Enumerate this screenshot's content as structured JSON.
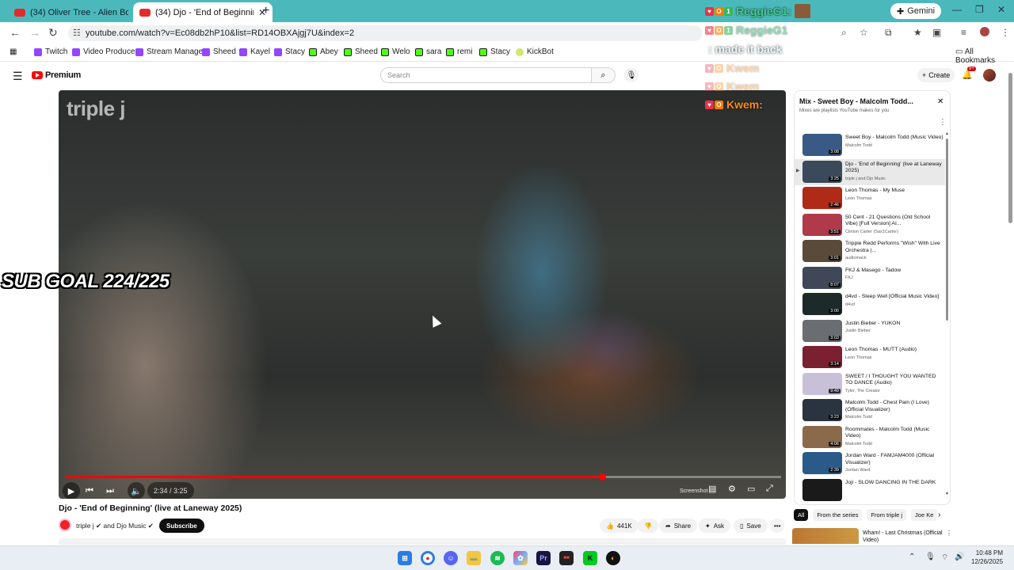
{
  "browser": {
    "tabs": [
      {
        "title": "(34) Oliver Tree - Alien Boy [Offi",
        "active": false
      },
      {
        "title": "(34) Djo - 'End of Beginning' (li",
        "active": true
      }
    ],
    "gemini_label": "Gemini",
    "url": "youtube.com/watch?v=Ec08db2hP10&list=RD14OBXAjgj7U&index=2",
    "bookmarks": [
      {
        "label": "Twitch",
        "icon": "twitch"
      },
      {
        "label": "Video Producer",
        "icon": "twitch"
      },
      {
        "label": "Stream Manager",
        "icon": "twitch"
      },
      {
        "label": "Sheed",
        "icon": "twitch"
      },
      {
        "label": "Kayel",
        "icon": "twitch"
      },
      {
        "label": "Stacy",
        "icon": "twitch"
      },
      {
        "label": "Abey",
        "icon": "kick"
      },
      {
        "label": "Sheed",
        "icon": "kick"
      },
      {
        "label": "Welo",
        "icon": "kick"
      },
      {
        "label": "sara",
        "icon": "kick"
      },
      {
        "label": "remi",
        "icon": "kick"
      },
      {
        "label": "Stacy",
        "icon": "kick"
      },
      {
        "label": "KickBot",
        "icon": "kickbot"
      }
    ],
    "all_bookmarks_label": "All Bookmarks"
  },
  "youtube": {
    "logo_label": "Premium",
    "search_placeholder": "Search",
    "create_label": "Create",
    "notification_count": "9+"
  },
  "player": {
    "watermark": "triple j",
    "time": "2:34 / 3:25",
    "progress": 0.75,
    "screenshot_label": "Screenshot"
  },
  "overlay": {
    "sub_goal": "SUB GOAL 224/225",
    "chat": [
      {
        "user": "ReggieG1:",
        "message": "",
        "color": "green"
      },
      {
        "user": "ReggieG1",
        "message": "",
        "color": "green"
      },
      {
        "user": "",
        "message": ": made it back",
        "color": "green"
      },
      {
        "user": "Kwem",
        "message": "",
        "color": "orange"
      },
      {
        "user": "Kwem",
        "message": "",
        "color": "orange"
      },
      {
        "user": "Kwem:",
        "message": "",
        "color": "orange"
      }
    ]
  },
  "video": {
    "title": "Djo - 'End of Beginning' (live at Laneway 2025)",
    "channel": "triple j ✔ and Djo Music ✔",
    "subscribe_label": "Subscribe",
    "likes": "441K",
    "share_label": "Share",
    "ask_label": "Ask",
    "save_label": "Save"
  },
  "playlist": {
    "title": "Mix - Sweet Boy - Malcolm Todd...",
    "subtitle": "Mixes are playlists YouTube makes for you",
    "items": [
      {
        "title": "Sweet Boy - Malcolm Todd (Music Video)",
        "channel": "Malcolm Todd",
        "duration": "3:08",
        "color": "#3a5a86"
      },
      {
        "title": "Djo - 'End of Beginning' (live at Laneway 2025)",
        "channel": "triple j and Djo Music",
        "duration": "3:25",
        "color": "#3b4a5a",
        "current": true
      },
      {
        "title": "Leon Thomas - My Muse",
        "channel": "Leon Thomas",
        "duration": "2:46",
        "color": "#b02a18"
      },
      {
        "title": "50 Cent - 21 Questions (Old School Vibe) [Full Version] AI...",
        "channel": "Clinton Carter (Sax1Carter)",
        "duration": "3:51",
        "color": "#b03a4a"
      },
      {
        "title": "Trippie Redd Performs \"Wish\" With Live Orchestra |...",
        "channel": "audiomack",
        "duration": "3:01",
        "color": "#5a4a3a"
      },
      {
        "title": "FKJ & Masego - Tadow",
        "channel": "FKJ",
        "duration": "8:07",
        "color": "#404858"
      },
      {
        "title": "d4vd - Sleep Well [Official Music Video]",
        "channel": "d4vd",
        "duration": "3:00",
        "color": "#1e2a2a"
      },
      {
        "title": "Justin Bieber - YUKON",
        "channel": "Justin Bieber",
        "duration": "3:03",
        "color": "#6a6e72"
      },
      {
        "title": "Leon Thomas - MUTT (Audio)",
        "channel": "Leon Thomas",
        "duration": "3:14",
        "color": "#7a2030"
      },
      {
        "title": "SWEET / I THOUGHT YOU WANTED TO DANCE (Audio)",
        "channel": "Tyler, The Creator",
        "duration": "9:49",
        "color": "#c8c0d8"
      },
      {
        "title": "Malcolm Todd - Chest Pain (I Love) (Official Visualizer)",
        "channel": "Malcolm Todd",
        "duration": "3:23",
        "color": "#2a3440"
      },
      {
        "title": "Roommates - Malcolm Todd (Music Video)",
        "channel": "Malcolm Todd",
        "duration": "4:06",
        "color": "#8a6a4a"
      },
      {
        "title": "Jordan Ward - FAMJAM4000 (Official Visualizer)",
        "channel": "Jordan Ward",
        "duration": "2:39",
        "color": "#2a5a8a"
      },
      {
        "title": "Joji - SLOW DANCING IN THE DARK",
        "channel": "",
        "duration": "",
        "color": "#1a1a1a"
      }
    ],
    "chips": [
      "All",
      "From the series",
      "From triple j",
      "Joe Ke"
    ]
  },
  "recommendation": {
    "title": "Wham! - Last Christmas (Official Video)"
  },
  "taskbar": {
    "time": "10:48 PM",
    "date": "12/26/2025"
  }
}
